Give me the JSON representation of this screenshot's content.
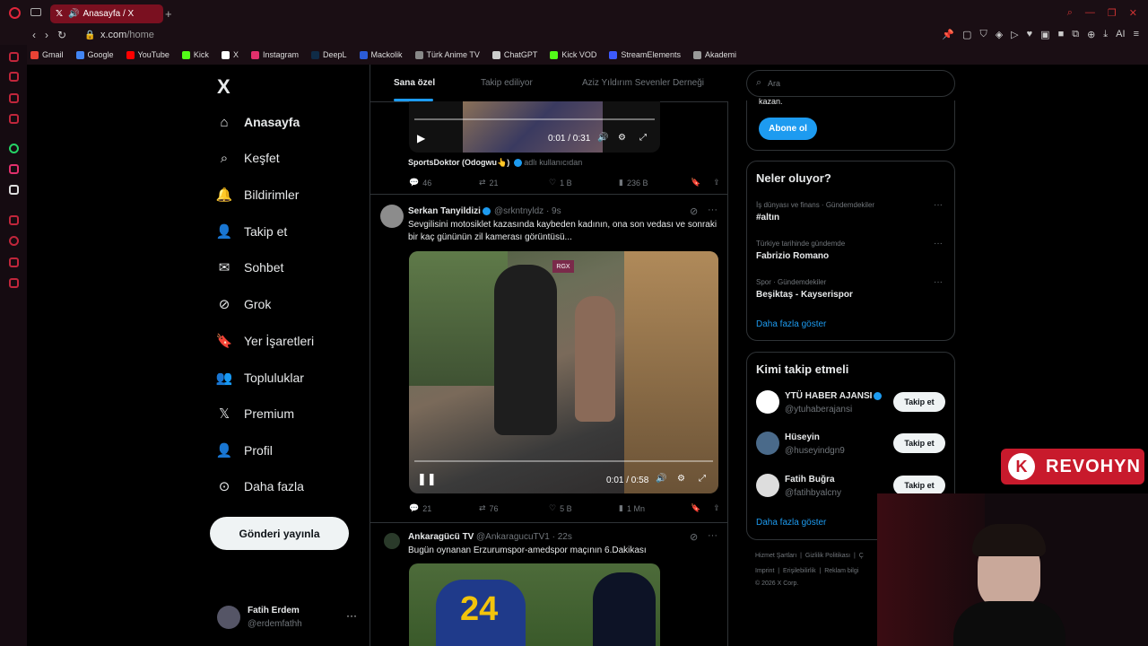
{
  "browser": {
    "tab_title": "Anasayfa / X",
    "url_host": "x.com",
    "url_path": "/home",
    "ai_label": "AI"
  },
  "bookmarks": [
    {
      "label": "Gmail",
      "color": "#ea4335"
    },
    {
      "label": "Google",
      "color": "#4285f4"
    },
    {
      "label": "YouTube",
      "color": "#ff0000"
    },
    {
      "label": "Kick",
      "color": "#53fc18"
    },
    {
      "label": "X",
      "color": "#ffffff"
    },
    {
      "label": "Instagram",
      "color": "#e1306c"
    },
    {
      "label": "DeepL",
      "color": "#0f2b46"
    },
    {
      "label": "Mackolik",
      "color": "#2b5bd7"
    },
    {
      "label": "Türk Anime TV",
      "color": "#888888"
    },
    {
      "label": "ChatGPT",
      "color": "#cccccc"
    },
    {
      "label": "Kick VOD",
      "color": "#53fc18"
    },
    {
      "label": "StreamElements",
      "color": "#3d5afe"
    },
    {
      "label": "Akademi",
      "color": "#999999"
    }
  ],
  "nav": {
    "logo": "X",
    "items": [
      {
        "label": "Anasayfa",
        "icon": "home-icon"
      },
      {
        "label": "Keşfet",
        "icon": "search-icon"
      },
      {
        "label": "Bildirimler",
        "icon": "bell-icon"
      },
      {
        "label": "Takip et",
        "icon": "add-user-icon"
      },
      {
        "label": "Sohbet",
        "icon": "mail-icon"
      },
      {
        "label": "Grok",
        "icon": "grok-icon"
      },
      {
        "label": "Yer İşaretleri",
        "icon": "bookmark-icon"
      },
      {
        "label": "Topluluklar",
        "icon": "communities-icon"
      },
      {
        "label": "Premium",
        "icon": "x-icon"
      },
      {
        "label": "Profil",
        "icon": "person-icon"
      },
      {
        "label": "Daha fazla",
        "icon": "more-circle-icon"
      }
    ],
    "post_button": "Gönderi yayınla",
    "account": {
      "name": "Fatih Erdem",
      "handle": "@erdemfathh",
      "more": "···"
    }
  },
  "feed": {
    "tabs": [
      "Sana özel",
      "Takip ediliyor",
      "Aziz Yıldırım Sevenler Derneği"
    ],
    "tweet0": {
      "time": "0:01 / 0:31",
      "credit_name": "SportsDoktor (Odogwu👆)",
      "credit_suffix": "adlı kullanıcıdan",
      "stats": {
        "replies": "46",
        "reposts": "21",
        "likes": "1 B",
        "views": "236 B"
      }
    },
    "tweet1": {
      "name": "Serkan Tanyildizi",
      "handle": "@srkntnyldz · 9s",
      "text": "Sevgilisini motosiklet kazasında kaybeden kadının, ona son vedası ve sonraki bir kaç gününün zil kamerası görüntüsü...",
      "video_tag": "RGX",
      "time": "0:01 / 0:58",
      "stats": {
        "replies": "21",
        "reposts": "76",
        "likes": "5 B",
        "views": "1 Mn"
      }
    },
    "tweet2": {
      "name": "Ankaragücü TV",
      "handle": "@AnkaragucuTV1 · 22s",
      "text": "Bugün oynanan Erzurumspor-amedspor maçının 6.Dakikası",
      "jersey": "24"
    }
  },
  "right": {
    "search_placeholder": "Ara",
    "premium_tail": "kazan.",
    "subscribe": "Abone ol",
    "trends_title": "Neler oluyor?",
    "trends": [
      {
        "meta": "İş dünyası ve finans · Gündemdekiler",
        "name": "#altın"
      },
      {
        "meta": "Türkiye tarihinde gündemde",
        "name": "Fabrizio Romano"
      },
      {
        "meta": "Spor · Gündemdekiler",
        "name": "Beşiktaş - Kayserispor"
      }
    ],
    "show_more": "Daha fazla göster",
    "wtf_title": "Kimi takip etmeli",
    "wtf": [
      {
        "name": "YTÜ HABER AJANSI",
        "handle": "@ytuhaberajansi",
        "button": "Takip et"
      },
      {
        "name": "Hüseyin",
        "handle": "@huseyindgn9",
        "button": "Takip et"
      },
      {
        "name": "Fatih Buğra",
        "handle": "@fatihbyalcny",
        "button": "Takip et"
      }
    ],
    "footer": [
      "Hizmet Şartları",
      "Gizlilik Politikası",
      "Ç",
      "Imprint",
      "Erişilebilirlik",
      "Reklam bilgi",
      "© 2026 X Corp."
    ]
  },
  "overlay": {
    "badge_letter": "K",
    "badge_text": "REVOHYN"
  }
}
